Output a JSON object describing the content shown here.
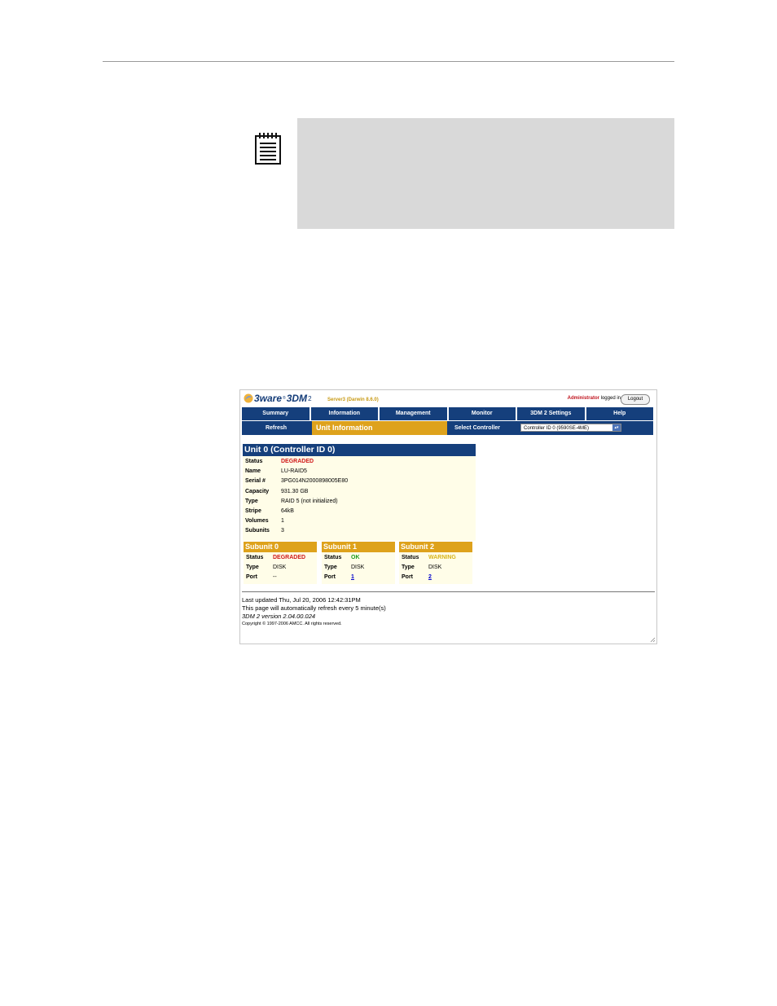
{
  "header": {
    "server": "Server3 (Darwin 8.6.0)",
    "user": "Administrator",
    "logged_in": "logged in",
    "logout": "Logout"
  },
  "logo": {
    "brand": "3ware",
    "registered": "®",
    "product": "3DM",
    "version_mark": "2"
  },
  "nav": {
    "tabs": [
      "Summary",
      "Information",
      "Management",
      "Monitor",
      "3DM 2 Settings",
      "Help"
    ],
    "refresh": "Refresh",
    "current_page": "Unit Information",
    "select_controller_label": "Select Controller",
    "controller_value": "Controller ID 0 (9590SE-4ME)"
  },
  "unit": {
    "title": "Unit 0 (Controller ID 0)",
    "props": [
      {
        "k": "Status",
        "v": "DEGRADED"
      },
      {
        "k": "Name",
        "v": "LU-RAID5"
      },
      {
        "k": "Serial #",
        "v": "3PG014N2000898005E80"
      },
      {
        "k": "Capacity",
        "v": "931.30 GB"
      },
      {
        "k": "Type",
        "v": "RAID 5 (not initialized)"
      },
      {
        "k": "Stripe",
        "v": "64kB"
      },
      {
        "k": "Volumes",
        "v": "1"
      },
      {
        "k": "Subunits",
        "v": "3"
      }
    ]
  },
  "subunits": [
    {
      "title": "Subunit 0",
      "status_label": "Status",
      "status": "DEGRADED",
      "type_label": "Type",
      "type": "DISK",
      "port_label": "Port",
      "port": "--"
    },
    {
      "title": "Subunit 1",
      "status_label": "Status",
      "status": "OK",
      "type_label": "Type",
      "type": "DISK",
      "port_label": "Port",
      "port": "1"
    },
    {
      "title": "Subunit 2",
      "status_label": "Status",
      "status": "WARNING",
      "type_label": "Type",
      "type": "DISK",
      "port_label": "Port",
      "port": "2"
    }
  ],
  "footer": {
    "updated": "Last updated Thu, Jul 20, 2006 12:42:31PM",
    "refresh_note": "This page will automatically refresh every 5 minute(s)",
    "version": "3DM 2 version 2.04.00.024",
    "copyright": "Copyright © 1997-2006 AMCC. All rights reserved."
  }
}
